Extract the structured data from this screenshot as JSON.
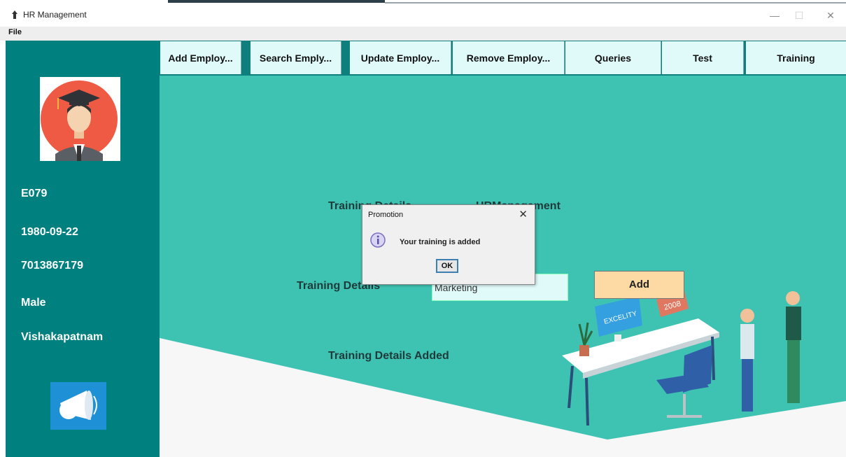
{
  "window": {
    "title": "HR Management",
    "min_icon": "minimize-icon",
    "max_icon": "maximize-icon",
    "close_icon": "close-icon"
  },
  "menu": {
    "file": "File"
  },
  "sidebar": {
    "emp_id": "E079",
    "dob": "1980-09-22",
    "phone": "7013867179",
    "gender": "Male",
    "city": "Vishakapatnam",
    "avatar_icon": "graduate-avatar-icon",
    "announce_icon": "megaphone-icon"
  },
  "tabs": [
    "Add Employ...",
    "Search Emply...",
    "Update Employ...",
    "Remove Employ...",
    "Queries",
    "Test",
    "Training"
  ],
  "main": {
    "heading_left": "Training Details",
    "heading_right": "HRManagement",
    "field_label": "Training Details",
    "field_value": "Marketing",
    "add_button": "Add",
    "status": "Training Details Added",
    "illustration_label_1": "EXCELITY",
    "illustration_label_2": "2008"
  },
  "dialog": {
    "title": "Promotion",
    "message": "Your training is added",
    "ok": "OK",
    "icon": "info-icon"
  },
  "colors": {
    "sidebar": "#00807f",
    "main": "#3ec3b3",
    "tab": "#e0fafa",
    "add_button": "#fdd9a3"
  }
}
